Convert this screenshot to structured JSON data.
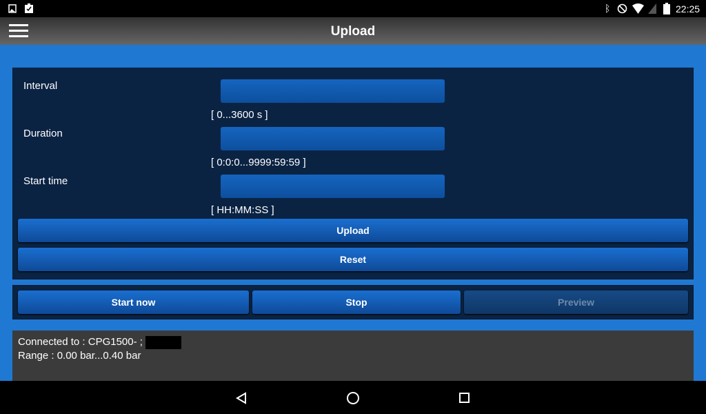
{
  "status_bar": {
    "time": "22:25",
    "icons": [
      "image-icon",
      "clipboard-check-icon",
      "bluetooth-icon",
      "do-not-disturb-icon",
      "wifi-icon",
      "no-signal-icon",
      "battery-icon"
    ]
  },
  "app_bar": {
    "title": "Upload",
    "menu_icon": "hamburger-icon"
  },
  "form": {
    "fields": [
      {
        "label": "Interval",
        "value": "",
        "hint": "[ 0...3600 s ]"
      },
      {
        "label": "Duration",
        "value": "",
        "hint": "[ 0:0:0...9999:59:59 ]"
      },
      {
        "label": "Start time",
        "value": "",
        "hint": "[ HH:MM:SS ]"
      }
    ],
    "upload_label": "Upload",
    "reset_label": "Reset"
  },
  "controls": {
    "start_label": "Start now",
    "stop_label": "Stop",
    "preview_label": "Preview"
  },
  "info": {
    "connected": "Connected to : CPG1500- ;",
    "range": "Range : 0.00 bar...0.40 bar"
  },
  "colors": {
    "background": "#1f78d1",
    "panel": "#0b2343",
    "button": "#1a6fd0"
  }
}
